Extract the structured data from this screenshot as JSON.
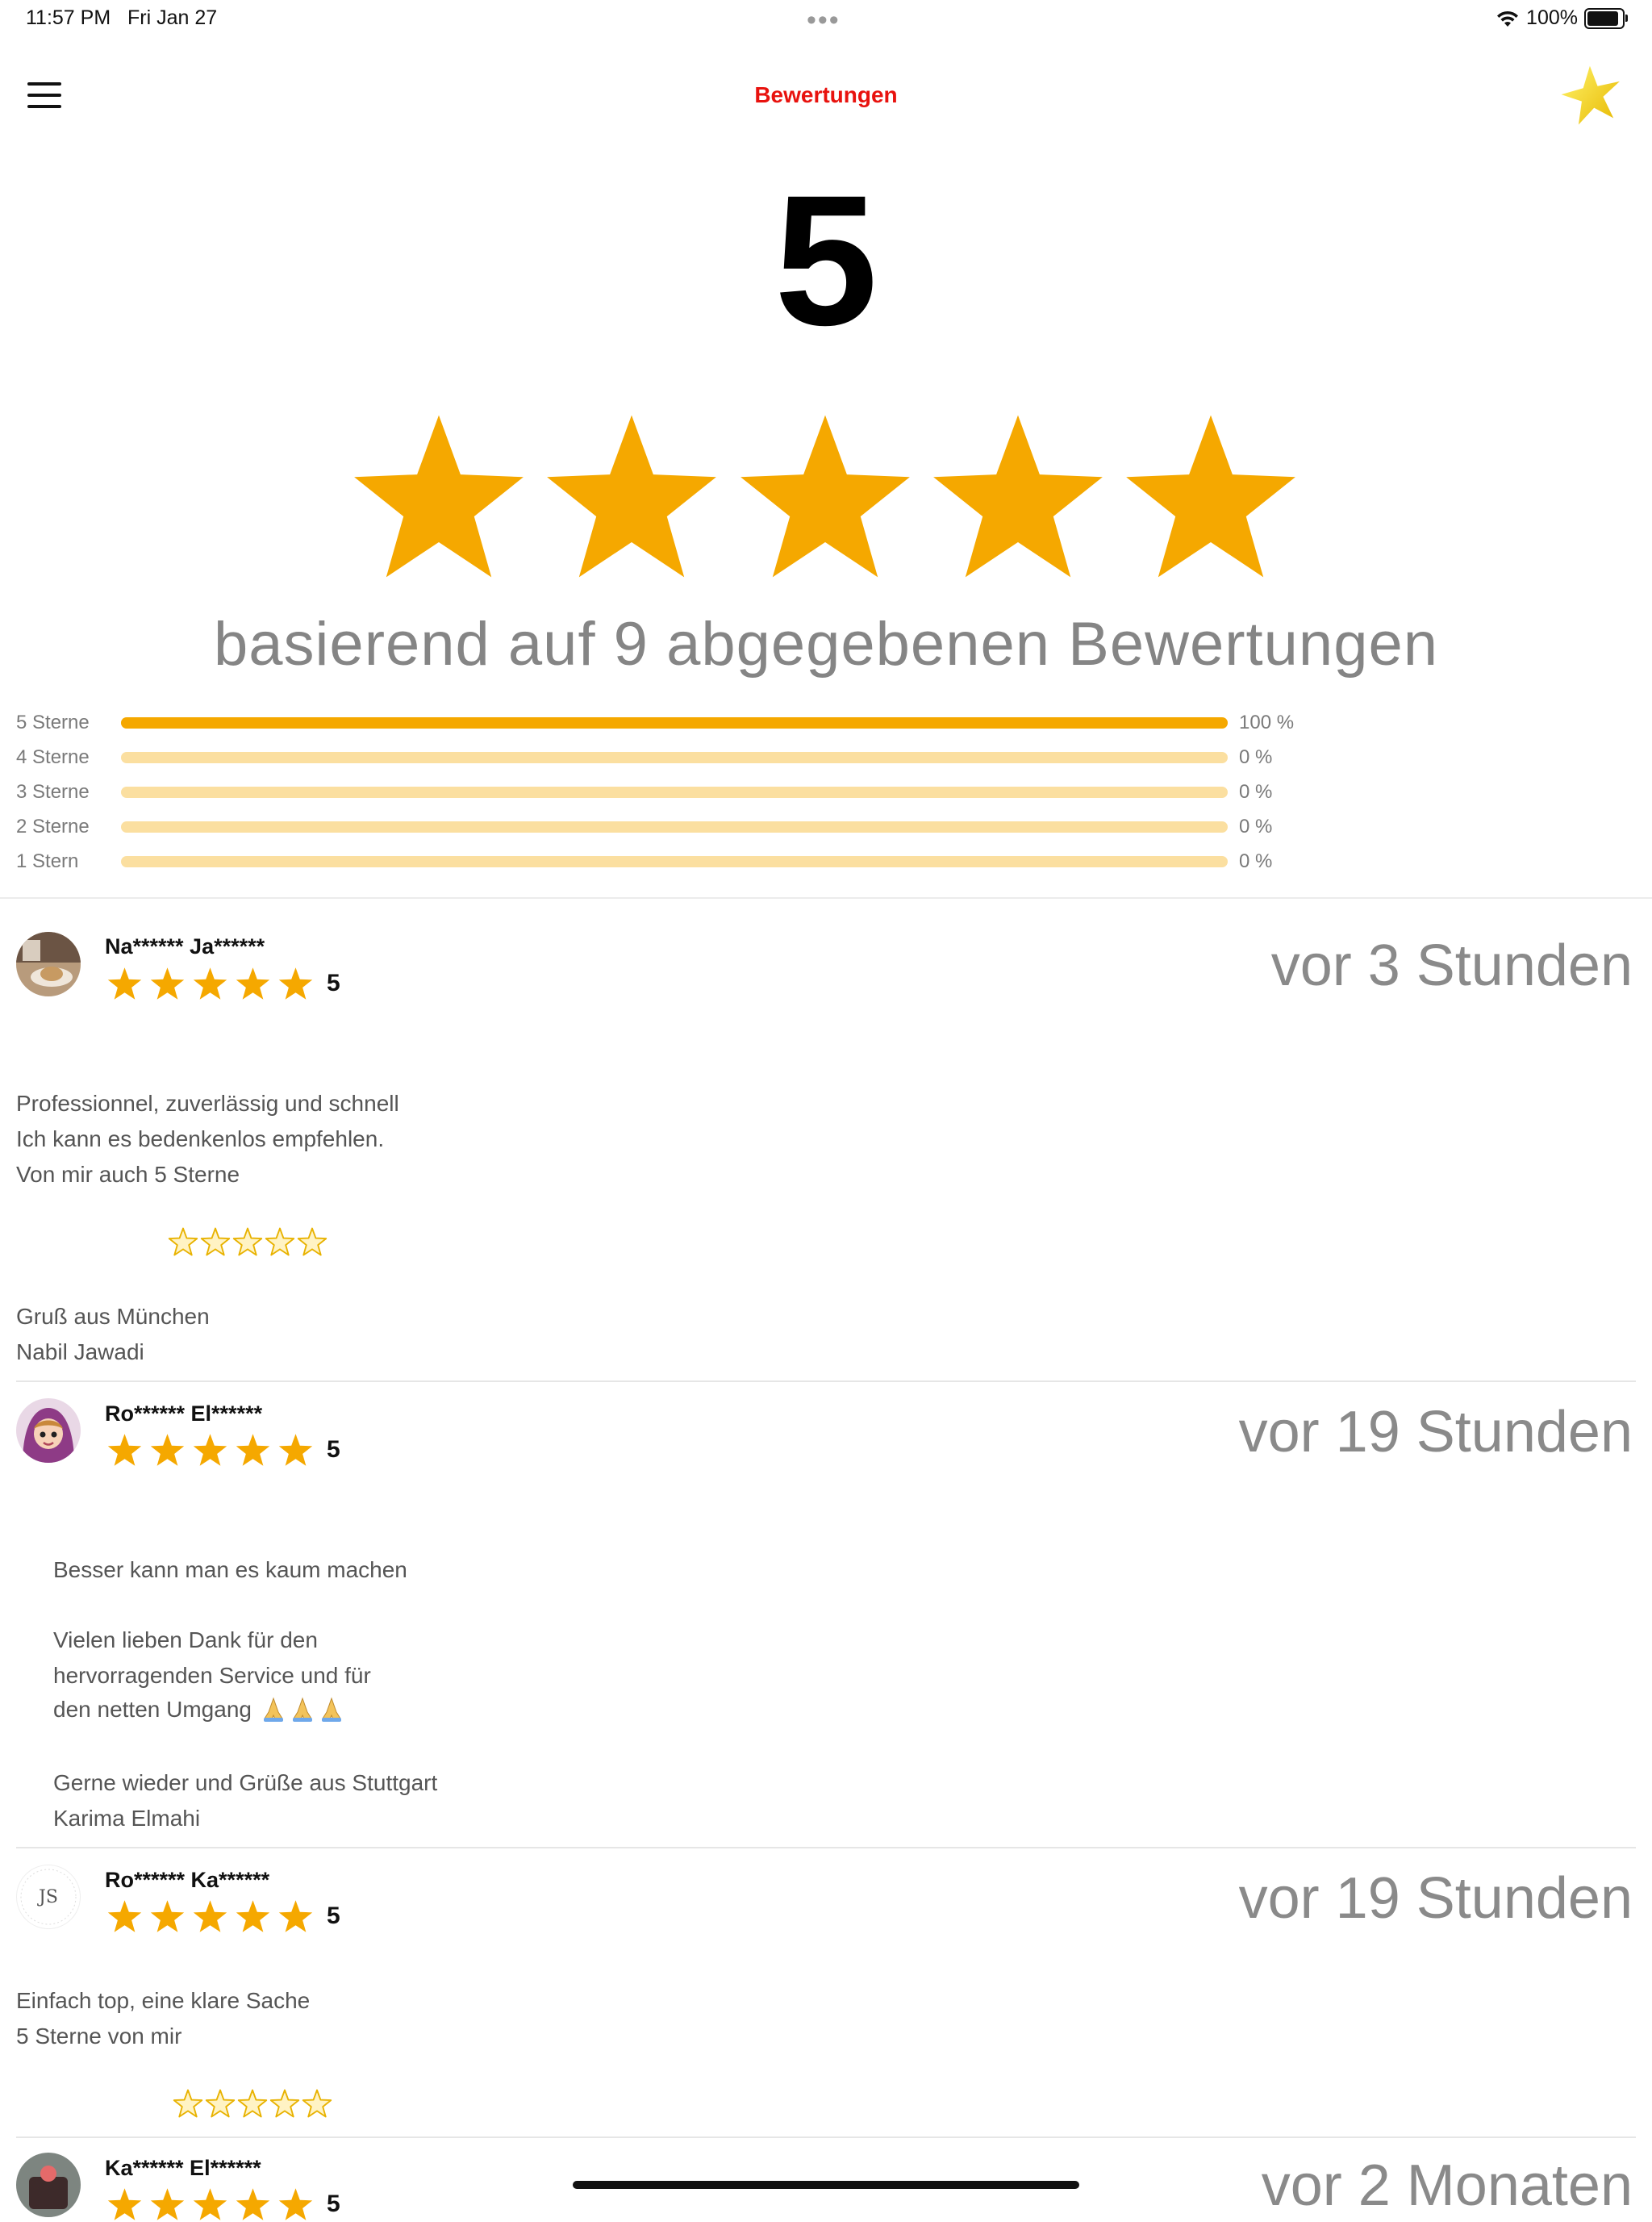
{
  "status_bar": {
    "time": "11:57 PM",
    "date": "Fri Jan 27",
    "battery": "100%",
    "battery_level": 1.0,
    "wifi_icon": "wifi-icon"
  },
  "nav": {
    "title": "Bewertungen",
    "menu_icon": "hamburger-icon",
    "logo_icon": "star-logo-icon"
  },
  "summary": {
    "score": "5",
    "stars": 5,
    "based_on": "basierend auf 9 abgegebenen Bewertungen",
    "distribution": [
      {
        "label": "5 Sterne",
        "percent_text": "100 %",
        "percent": 100
      },
      {
        "label": "4 Sterne",
        "percent_text": "0 %",
        "percent": 0
      },
      {
        "label": "3 Sterne",
        "percent_text": "0 %",
        "percent": 0
      },
      {
        "label": "2 Sterne",
        "percent_text": "0 %",
        "percent": 0
      },
      {
        "label": "1 Stern",
        "percent_text": "0 %",
        "percent": 0
      }
    ]
  },
  "reviews": [
    {
      "name": "Na****** Ja******",
      "rating": "5",
      "stars": 5,
      "time": "vor 3 Stunden",
      "avatar": "photo-avatar",
      "text_1": "Professionnel, zuverlässig und schnell\nIch kann es bedenkenlos empfehlen.\nVon mir auch  5 Sterne",
      "text_2": "Gruß aus München\nNabil Jawadi"
    },
    {
      "name": "Ro****** El******",
      "rating": "5",
      "stars": 5,
      "time": "vor 19 Stunden",
      "avatar": "cartoon-avatar",
      "text_1": "Besser kann man es kaum machen",
      "text_2": "Vielen lieben Dank für den\nhervorragenden Service und für",
      "text_3": "den netten Umgang",
      "text_4": "Gerne wieder und Grüße aus Stuttgart\nKarima Elmahi"
    },
    {
      "name": "Ro****** Ka******",
      "rating": "5",
      "stars": 5,
      "time": "vor 19 Stunden",
      "avatar": "monogram-avatar",
      "avatar_text": "JS",
      "text_1": "Einfach top, eine klare Sache\n5 Sterne von mir"
    },
    {
      "name": "Ka****** El******",
      "rating": "5",
      "stars": 5,
      "time": "vor 2 Monaten",
      "avatar": "cake-avatar"
    }
  ],
  "colors": {
    "accent_red": "#e8120e",
    "star": "#f5a800",
    "track": "#fbdfa0",
    "muted_text": "#858585"
  }
}
